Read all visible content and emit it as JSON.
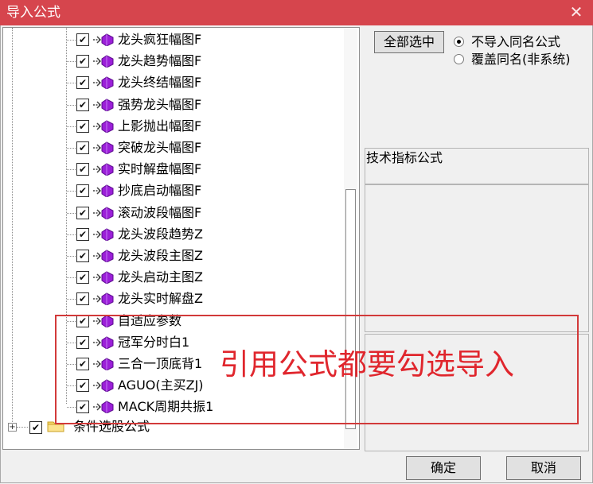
{
  "window": {
    "title": "导入公式"
  },
  "tree": {
    "items": [
      {
        "label": "龙头疯狂幅图F"
      },
      {
        "label": "龙头趋势幅图F"
      },
      {
        "label": "龙头终结幅图F"
      },
      {
        "label": "强势龙头幅图F"
      },
      {
        "label": "上影抛出幅图F"
      },
      {
        "label": "突破龙头幅图F"
      },
      {
        "label": "实时解盘幅图F"
      },
      {
        "label": "抄底启动幅图F"
      },
      {
        "label": "滚动波段幅图F"
      },
      {
        "label": "龙头波段趋势Z"
      },
      {
        "label": "龙头波段主图Z"
      },
      {
        "label": "龙头启动主图Z"
      },
      {
        "label": "龙头实时解盘Z"
      },
      {
        "label": "自适应参数"
      },
      {
        "label": "冠军分时白1"
      },
      {
        "label": "三合一顶底背1"
      },
      {
        "label": "AGUO(主买ZJ)"
      },
      {
        "label": "MACK周期共振1"
      }
    ],
    "root": {
      "label": "条件选股公式"
    }
  },
  "options": {
    "select_all": "全部选中",
    "radio1": "不导入同名公式",
    "radio2": "覆盖同名(非系统)",
    "selected": "radio1"
  },
  "panel": {
    "title": "技术指标公式"
  },
  "buttons": {
    "ok": "确定",
    "cancel": "取消"
  },
  "annotation": {
    "text": "引用公式都要勾选导入",
    "color": "#e0262d"
  },
  "colors": {
    "titlebar": "#d6454d",
    "formula_icon": "#9b1fd8"
  }
}
